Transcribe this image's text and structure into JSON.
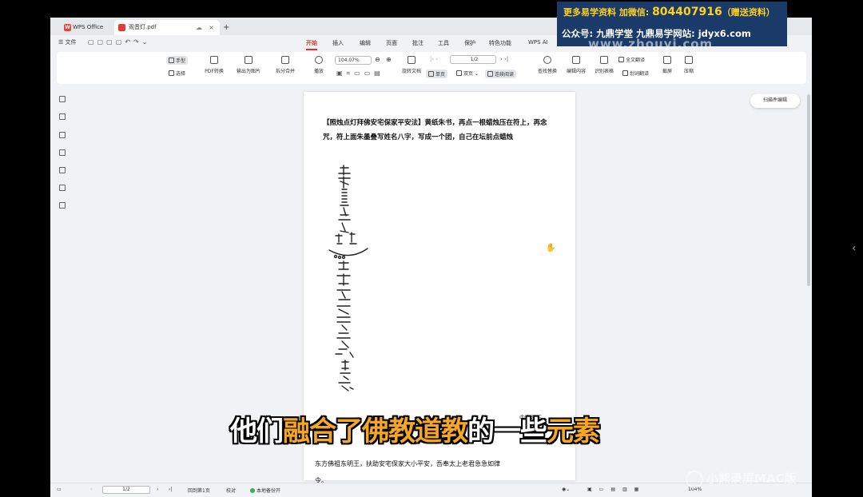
{
  "tabs": {
    "app_tab": "WPS Office",
    "file_tab": "观音灯.pdf",
    "new_tab": "+"
  },
  "menu": {
    "file": "文件",
    "tabs": [
      "开始",
      "插入",
      "编辑",
      "页面",
      "批注",
      "工具",
      "保护",
      "特色功能",
      "WPS AI"
    ],
    "active_tab": "开始"
  },
  "ribbon": {
    "hand": "手型",
    "select": "选择",
    "pdf_convert": "PDF转换",
    "export_image": "输出为图片",
    "split_merge": "拆分合并",
    "play": "播放",
    "zoom": "104.07%",
    "rotate": "旋转文档",
    "page_field": "1/2",
    "single": "单页",
    "double": "双页",
    "continuous": "连续阅读",
    "find_replace": "查找替换",
    "edit_content": "编辑内容",
    "recognize_table": "识别表格",
    "full_translate": "全文翻译",
    "word_translate": "划词翻译",
    "screenshot": "截屏",
    "compress": "压缩"
  },
  "document": {
    "title_text": "【照烛点灯拜佛安宅保家平安法】黄纸朱书，再点一根蜡烛压在符上，再念咒，符上面朱墨叠写姓名八字，写成一个团，自己在坛前点蜡烛",
    "label_right": "中央照王",
    "line1": "东方佛祖东明王，扶助安宅保家大小平安，吾奉太上老君急急如律",
    "line2": "令。",
    "scan_edit": "扫描件编辑"
  },
  "statusbar": {
    "page": "1/2",
    "back_first": "回到第1页",
    "proofread": "校对",
    "backup": "本地备份开",
    "zoom": "104%"
  },
  "overlay": {
    "promo_line1_a": "更多易学资料 加微信: ",
    "promo_number": "804407916",
    "promo_line1_b": "（赠送资料）",
    "promo_line2": "公众号: 九鼎学堂 九鼎易学网站: jdyx6.com",
    "watermark": "www.zhouyi.com",
    "subtitle_parts": [
      {
        "text": "他们",
        "color": "white"
      },
      {
        "text": "融合了",
        "color": "orange"
      },
      {
        "text": "佛教道教",
        "color": "orange"
      },
      {
        "text": "的一些",
        "color": "white"
      },
      {
        "text": "元素",
        "color": "orange"
      }
    ],
    "recorder": "小熊录屏MAC版"
  },
  "colors": {
    "accent": "#d03a2f",
    "promo_bg": "#1a3a6a",
    "promo_number": "#ffd21e",
    "subtitle_orange": "#f5a623"
  }
}
